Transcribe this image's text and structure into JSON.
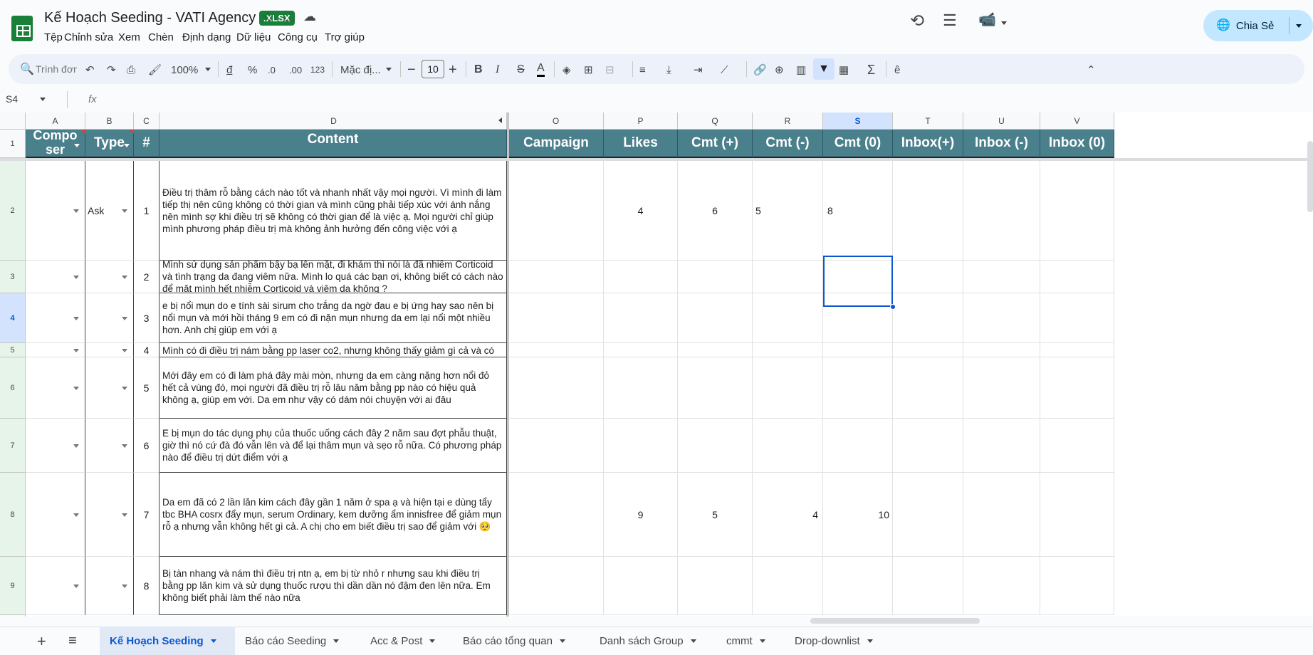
{
  "app": {
    "title": "Kế Hoạch Seeding - VATI Agency",
    "badge": ".XLSX",
    "menu": [
      "Tệp",
      "Chỉnh sửa",
      "Xem",
      "Chèn",
      "Định dạng",
      "Dữ liệu",
      "Công cụ",
      "Trợ giúp"
    ],
    "share_label": "Chia Sẻ"
  },
  "toolbar": {
    "search_placeholder": "Trình đơn",
    "zoom": "100%",
    "currency": "đ",
    "percent": "%",
    "dec_less": ".0",
    "dec_more": ".00",
    "number_fmt": "123",
    "font": "Mặc đị...",
    "font_size": "10",
    "bold": "B",
    "italic": "I",
    "strike": "S",
    "text_color": "A",
    "sum": "Σ"
  },
  "formula": {
    "cell_ref": "S4",
    "fx": "fx",
    "value": ""
  },
  "columns": [
    "A",
    "B",
    "C",
    "D",
    "O",
    "P",
    "Q",
    "R",
    "S",
    "T",
    "U",
    "V"
  ],
  "header_row": {
    "composer": "Compo ser",
    "type": "Type",
    "num": "#",
    "content": "Content",
    "campaign": "Campaign",
    "likes": "Likes",
    "cmt_pos": "Cmt (+)",
    "cmt_neg": "Cmt (-)",
    "cmt_zero": "Cmt (0)",
    "inbox_pos": "Inbox(+)",
    "inbox_neg": "Inbox (-)",
    "inbox_zero": "Inbox (0)"
  },
  "rows": [
    {
      "row": "2",
      "type": "Ask",
      "num": "1",
      "content": "Điều trị thâm rỗ bằng cách nào tốt và nhanh nhất vậy mọi người. Vì mình  đi làm tiếp thị nên cũng không có thời gian và mình cũng phải tiếp xúc với ánh nắng nên mình  sợ khi điều trị sẽ không có thời gian để là việc ạ. Mọi người chỉ giúp mình phương pháp điều trị mà không ảnh hưởng đến công việc với ạ",
      "likes": "4",
      "cmt_pos": "6",
      "cmt_neg": "5",
      "cmt_zero": "8"
    },
    {
      "row": "3",
      "type": "",
      "num": "2",
      "content": "Mình sử dụng sản phẩm bậy bạ lên mặt, đi khám thì nói là đã nhiễm Corticoid và tình trạng da đang viêm nữa. Mình lo quá các bạn ơi, không biết có cách nào để mặt mình hết nhiễm Corticoid và viêm da không ?",
      "likes": "",
      "cmt_pos": "",
      "cmt_neg": "",
      "cmt_zero": ""
    },
    {
      "row": "4",
      "type": "",
      "num": "3",
      "content": " e bị nổi mụn do e tính sài sirum cho trắng da ngờ đau e bị ứng hay sao nên bị nổi mụn và mới hồi tháng  9 em có đi nặn mụn nhưng da em lại nổi một nhiều hơn. Anh chị giúp em với ạ",
      "likes": "",
      "cmt_pos": "",
      "cmt_neg": "",
      "cmt_zero": ""
    },
    {
      "row": "5",
      "type": "",
      "num": "4",
      "content": "Mình có đi điều trị nám bằng pp laser co2, nhưng không thấy giảm gì cả và có vài chỗ",
      "likes": "",
      "cmt_pos": "",
      "cmt_neg": "",
      "cmt_zero": ""
    },
    {
      "row": "6",
      "type": "",
      "num": "5",
      "content": "Mới đây em có đi làm phá đây mài mòn, nhưng da em càng nặng hơn nổi đỏ hết cả vùng đó, mọi người đã điều trị rỗ lâu năm bằng pp nào có hiệu quả không ạ, giúp em với. Da em như vậy có dám nói chuyện với ai đâu",
      "likes": "",
      "cmt_pos": "",
      "cmt_neg": "",
      "cmt_zero": ""
    },
    {
      "row": "7",
      "type": "",
      "num": "6",
      "content": "E bị mụn do tác dụng phụ của thuốc uống cách đây 2 năm sau đợt phẫu thuật, giờ thì nó cứ đà đó vẫn lên và để lại thâm mụn và sẹo rỗ nữa. Có phương pháp nào để điều trị dứt điểm với ạ",
      "likes": "",
      "cmt_pos": "",
      "cmt_neg": "",
      "cmt_zero": ""
    },
    {
      "row": "8",
      "type": "",
      "num": "7",
      "content": "Da em đã có 2 lần lăn kim cách đây gần 1 năm ở spa ạ và hiện tại e dùng tẩy tbc BHA cosrx đẩy mụn, serum Ordinary, kem dưỡng ẩm innisfree để giảm mụn rỗ ạ nhưng vẫn không hết gì cả. A chị cho em biết điều trị sao để giảm với 🥺",
      "likes": "9",
      "cmt_pos": "5",
      "cmt_neg": "4",
      "cmt_zero": "10"
    },
    {
      "row": "9",
      "type": "",
      "num": "8",
      "content": "Bị tàn nhang và nám thì điều trị ntn ạ, em bị từ nhỏ r nhưng sau khi điều trị bằng pp lăn kim và sử dụng thuốc rượu thì dần dần nó đậm đen lên nữa. Em không biết phải làm thế nào nữa",
      "likes": "",
      "cmt_pos": "",
      "cmt_neg": "",
      "cmt_zero": ""
    }
  ],
  "tabs": [
    "Kế Hoạch Seeding",
    "Báo cáo Seeding",
    "Acc & Post",
    "Báo cáo tổng quan",
    "Danh sách Group",
    "cmmt",
    "Drop-downlist"
  ],
  "active_tab": "Kế Hoạch Seeding",
  "colors": {
    "header_teal": "#4a7f8c",
    "accent_blue": "#0b57d0",
    "share_bg": "#c2e7ff",
    "active_tab_bg": "#e1e9f7"
  }
}
